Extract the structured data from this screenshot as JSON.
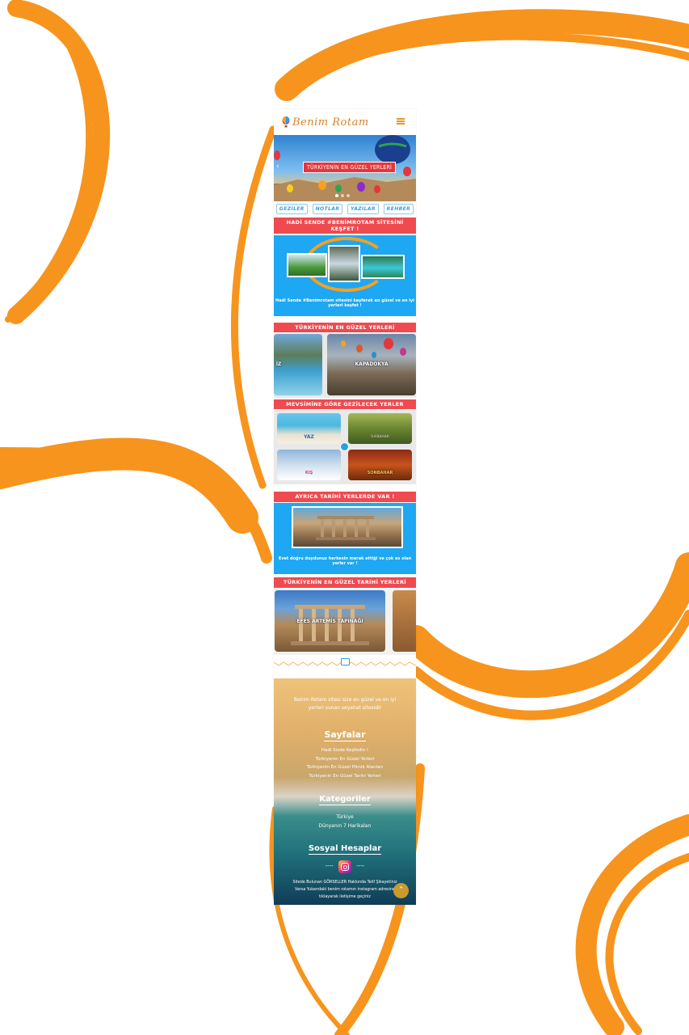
{
  "header": {
    "logo_text": "Benim Rotam",
    "menu_icon": "hamburger-icon"
  },
  "hero": {
    "caption": "TÜRKİYENİN EN GÜZEL YERLERİ",
    "slide_count": 3,
    "active_slide": 1
  },
  "tabs": [
    "GEZİLER",
    "NOTLAR",
    "YAZILAR",
    "REHBER"
  ],
  "section_discover": {
    "title": "HADİ SENDE #BENİMROTAM SİTESİNİ KEŞFET !",
    "text": "Hadi Sende #Benimrotam sitesini keşferek en güzel ve en iyi yerleri keşfet !"
  },
  "section_best": {
    "title": "TÜRKİYENİN EN GÜZEL YERLERİ",
    "cards": [
      {
        "label": "İZ"
      },
      {
        "label": "KAPADOKYA"
      }
    ]
  },
  "section_seasons": {
    "title": "MEVSİMİNE GÖRE GEZİLECEK YERLER",
    "cards": [
      {
        "label": "YAZ"
      },
      {
        "label": "İLKBAHAR"
      },
      {
        "label": "KIŞ"
      },
      {
        "label": "SONBAHAR"
      }
    ]
  },
  "section_history": {
    "title": "AYRICA TARİHİ YERLERDE VAR !",
    "text": "Evet doğru duydunuz herkesin merak ettiği ve çok es olan yerler var !"
  },
  "section_best_history": {
    "title": "TÜRKİYENİN EN GÜZEL TARİHİ YERLERİ",
    "cards": [
      {
        "label": "EFES ARTEMİS TAPINAĞI"
      }
    ]
  },
  "footer": {
    "intro": "Benim Rotam sitesi size en güzel ve en iyi yerleri sunan seyahat sitesidir",
    "pages_title": "Sayfalar",
    "pages": [
      "Hadi Sizde Keşfedin !",
      "Türkiyenin En Güzel Yerleri",
      "Türkiyenin En Güzel Piknik Alanları",
      "Türkiyenin En Güzel Tarihi Yerleri"
    ],
    "categories_title": "Kategoriler",
    "categories": [
      "Türkiye",
      "Dünyanın 7 Harikaları"
    ],
    "social_title": "Sosyal Hesaplar",
    "social_dash": "----",
    "disclaimer": [
      "Sitede Bulunan GÖRSELLER Hakkında Telif Şikayetiniz",
      "Varsa Yukarıdaki benim rotamın instagram adresine",
      "tıklayarak iletişime geçiniz"
    ]
  },
  "colors": {
    "accent_orange": "#f5a11f",
    "banner_red": "#ef4a4f",
    "blue_box": "#1ea7f2"
  }
}
